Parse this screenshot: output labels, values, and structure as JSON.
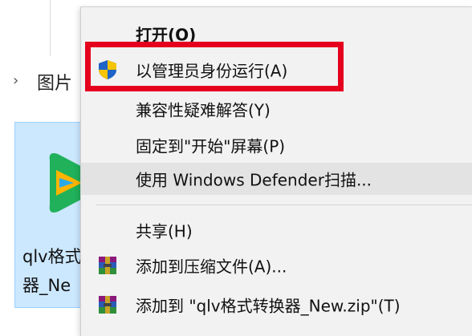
{
  "explorer": {
    "breadcrumb_label": "图片",
    "file_name_line1": "qlv格式",
    "file_name_line2": "器_Ne"
  },
  "context_menu": {
    "items": [
      {
        "label": "打开(O)",
        "bold": true
      },
      {
        "label": "以管理员身份运行(A)",
        "icon": "uac-shield-icon"
      },
      {
        "label": "兼容性疑难解答(Y)"
      },
      {
        "label": "固定到\"开始\"屏幕(P)"
      },
      {
        "label": "使用 Windows Defender扫描...",
        "highlighted": true
      },
      {
        "label": "共享(H)"
      },
      {
        "label": "添加到压缩文件(A)...",
        "icon": "winrar-icon"
      },
      {
        "label": "添加到 \"qlv格式转换器_New.zip\"(T)",
        "icon": "winrar-icon"
      }
    ]
  },
  "colors": {
    "highlight_box": "#e5001e",
    "menu_bg": "#f2f2f2",
    "hover_bg": "#e3e3e3",
    "selection_bg": "#cce8ff"
  }
}
